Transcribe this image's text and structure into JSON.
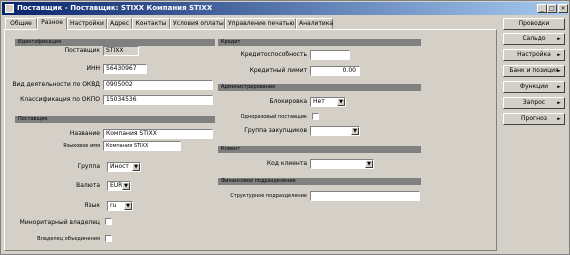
{
  "window": {
    "title": "Поставщик - Поставщик: STIXX Компания STIXX",
    "minimize": "_",
    "maximize": "□",
    "close": "×"
  },
  "tabs": [
    "Общие",
    "Разное",
    "Настройки",
    "Адрес",
    "Контакты",
    "Условия оплаты",
    "Управление печатью",
    "Аналитика"
  ],
  "left": {
    "section_id": "Идентификация",
    "supplier_label": "Поставщик",
    "supplier_value": "STIXX",
    "inn_label": "ИНН",
    "inn_value": "56430967",
    "okvd_label": "Вид деятельности по ОКВД",
    "okvd_value": "0905002",
    "okpo_label": "Классификация по ОКПО",
    "okpo_value": "15034536",
    "section_supplier": "Поставщик",
    "name_label": "Название",
    "name_value": "Компания STIXX",
    "lang_name_label": "Языковое имя",
    "lang_name_value": "Компания STIXX",
    "group_label": "Группа",
    "group_value": "Иност",
    "currency_label": "Валюта",
    "currency_value": "EUR",
    "language_label": "Язык",
    "language_value": "ru",
    "minor_label": "Миноритарный владелец",
    "merge_label": "Владелец объединения"
  },
  "right": {
    "section_credit": "Кредит",
    "creditworth_label": "Кредитоспособность",
    "creditworth_value": "",
    "credit_limit_label": "Кредитный лимит",
    "credit_limit_value": "0.00",
    "section_admin": "Администрирование",
    "block_label": "Блокировка",
    "block_value": "Нет",
    "onetime_label": "Одноразовый поставщик",
    "buyer_group_label": "Группа закупщиков",
    "buyer_group_value": "",
    "section_client": "Клиент",
    "client_code_label": "Код клиента",
    "client_code_value": "",
    "section_structure": "Финансовое подразделение",
    "structure_label": "Структурное подразделение",
    "structure_value": ""
  },
  "side_buttons": [
    {
      "label": "Проводки",
      "arrow": ""
    },
    {
      "label": "Сальдо",
      "arrow": "►"
    },
    {
      "label": "Настройка",
      "arrow": "►"
    },
    {
      "label": "Банк и позиция",
      "arrow": "►"
    },
    {
      "label": "Функции",
      "arrow": "►"
    },
    {
      "label": "Запрос",
      "arrow": "►"
    },
    {
      "label": "Прогноз",
      "arrow": "►"
    }
  ]
}
